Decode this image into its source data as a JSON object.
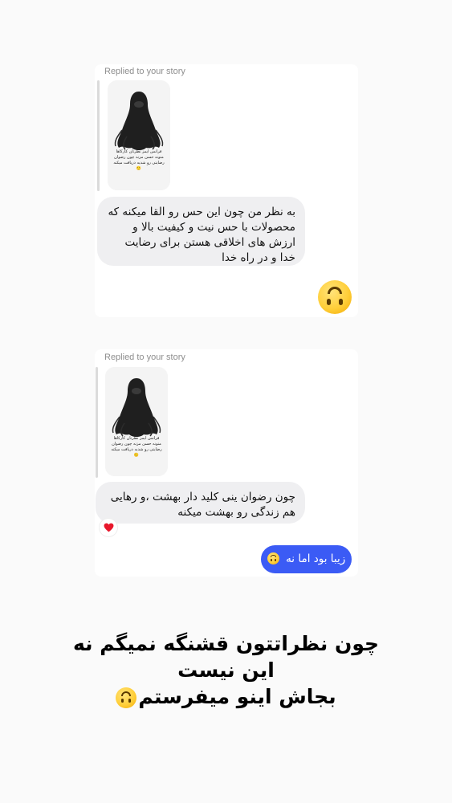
{
  "messages": [
    {
      "replied_label": "Replied to your story",
      "story_caption": "فرانس ایمز نظرتان کارکاها متونه حسن مزنه چون رضوان رضایتی رو شدیه دریافت میکنه🙂",
      "incoming_text": "به نظر من چون این حس رو القا میکنه که محصولات با حس نیت و کیفیت بالا و ارزش های اخلاقی هستن برای رضایت خدا و در راه خدا",
      "outgoing_emoji": "upside-down-face-emoji"
    },
    {
      "replied_label": "Replied to your story",
      "story_caption": "فرانس ایمز نظرتان کارکاها متونه حسن مزنه چون رضوان رضایتی رو شدیه دریافت میکنه🙂",
      "incoming_text": "چون رضوان ینی کلید دار بهشت ،و رهایی هم زندگی رو بهشت میکنه",
      "reaction": "❤️",
      "outgoing_text": "زیبا بود اما نه"
    }
  ],
  "caption": {
    "line1": "چون نظراتتون قشنگه نمیگم نه",
    "line2": "این نیست",
    "line3": "بجاش اینو میفرستم"
  },
  "colors": {
    "outgoing_bubble": "#3b5bf5",
    "incoming_bubble": "#efeff1",
    "background": "#fafafa"
  }
}
